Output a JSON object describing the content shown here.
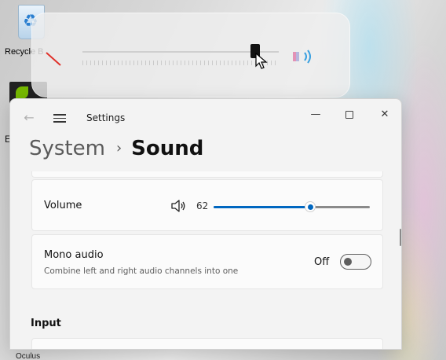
{
  "desktop": {
    "recycle_bin_label": "Recycle B",
    "side_fragment": "E",
    "bottom_fragment": "Oculus"
  },
  "flyout": {
    "accent": "#111111"
  },
  "window": {
    "title": "Settings",
    "back_label": "←",
    "minimize_label": "—",
    "close_label": "✕"
  },
  "breadcrumb": {
    "parent": "System",
    "separator": "›",
    "current": "Sound"
  },
  "volume": {
    "label": "Volume",
    "value": "62",
    "level": 0.62,
    "accent": "#0067c0"
  },
  "mono_audio": {
    "title": "Mono audio",
    "description": "Combine left and right audio channels into one",
    "state": "Off"
  },
  "sections": {
    "input": "Input"
  }
}
